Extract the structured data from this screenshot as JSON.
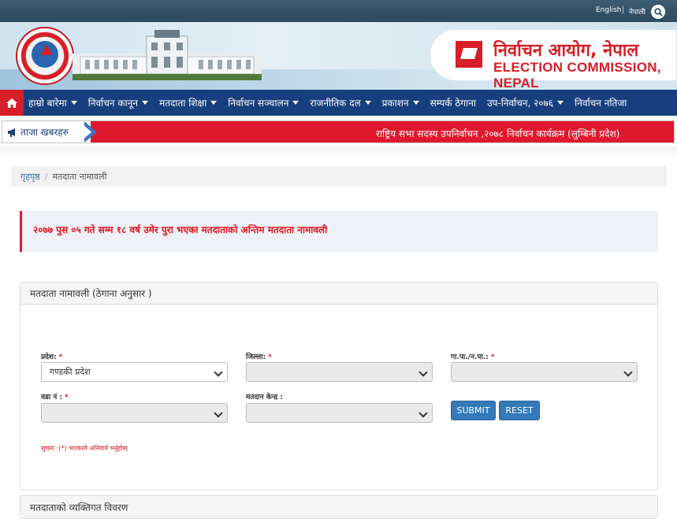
{
  "topbar": {
    "english_label": "English",
    "separator": "|",
    "nepali_label": "नेपाली"
  },
  "banner": {
    "logo_text_np": "निर्वाचन आयोग, नेपाल",
    "logo_text_en": "ELECTION COMMISSION, NEPAL"
  },
  "nav": {
    "home_icon": "home-icon",
    "items": [
      {
        "label": "हाम्रो बारेमा",
        "dropdown": true
      },
      {
        "label": "निर्वाचन कानून",
        "dropdown": true
      },
      {
        "label": "मतदाता शिक्षा",
        "dropdown": true
      },
      {
        "label": "निर्वाचन सञ्चालन",
        "dropdown": true
      },
      {
        "label": "राजनीतिक दल",
        "dropdown": true
      },
      {
        "label": "प्रकाशन",
        "dropdown": true
      },
      {
        "label": "सम्पर्क ठेगाना",
        "dropdown": false
      },
      {
        "label": "उप-निर्वाचन, २०७६",
        "dropdown": true
      },
      {
        "label": "निर्वाचन नतिजा",
        "dropdown": false
      }
    ]
  },
  "ticker": {
    "label": "ताजा खबरहरु",
    "text": "राष्ट्रिय सभा सदस्य उपनिर्वाचन ,२०७८ निर्वाचन कार्यक्रम (लुम्बिनी प्रदेश)"
  },
  "breadcrumb": {
    "home": "गृहपृष्ठ",
    "separator": "/",
    "current": "मतदाता नामावली"
  },
  "notice": {
    "text": "२०७७ पुस ०५ गते सम्म १८ वर्ष उमेर पुरा भएका मतदाताको अन्तिम मतदाता नामावली"
  },
  "form": {
    "title": "मतदाता नामावली (ठेगाना अनुसार )",
    "province": {
      "label": "प्रदेश:",
      "required_mark": "*",
      "value": "गण्डकी प्रदेश"
    },
    "district": {
      "label": "जिल्ला:",
      "required_mark": "*",
      "value": ""
    },
    "municipality": {
      "label": "गा.पा./न.पा.:",
      "required_mark": "*",
      "value": ""
    },
    "ward": {
      "label": "वडा नं :",
      "required_mark": "*",
      "value": ""
    },
    "center": {
      "label": "मतदान केन्द्र :",
      "value": ""
    },
    "submit_label": "SUBMIT",
    "reset_label": "RESET",
    "note": "सुचना :(*) भएकाले अनिवार्य भर्नुहोस्"
  },
  "details_panel": {
    "title": "मतदाताको व्यक्तिगत विवरण"
  },
  "colors": {
    "nav_bg": "#173f7e",
    "ticker_bg": "#e0182d",
    "accent_red": "#d61f26",
    "button_blue": "#337ab7"
  }
}
